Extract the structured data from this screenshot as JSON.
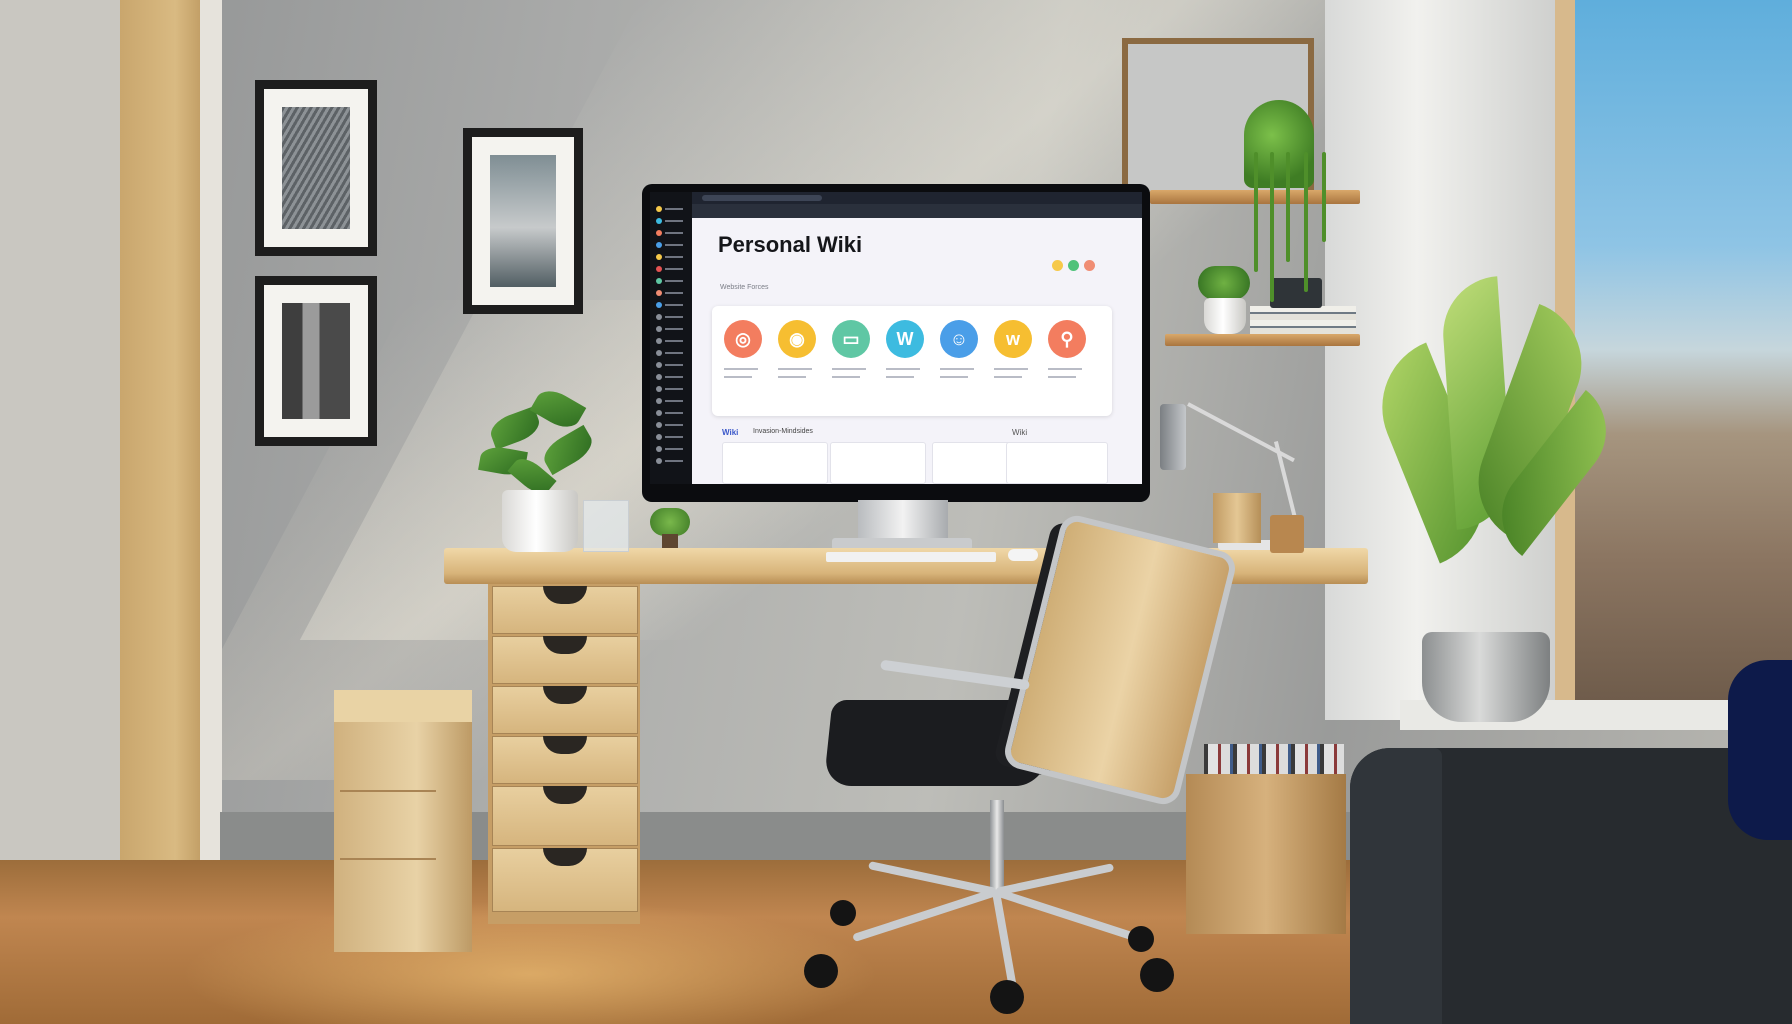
{
  "scene": "home office with desk and monitor",
  "colors": {
    "wall": "#a9aaa9",
    "desk_wood": "#d8b47a",
    "floor": "#c08650",
    "screen_bg": "#f4f3f9",
    "sidebar": "#111318",
    "accent_blue": "#3a57c9"
  },
  "screen": {
    "page_title": "Personal Wiki",
    "page_subtitle": "Website Forces",
    "header_dots": [
      "#f6c94a",
      "#4fc27a",
      "#f08d74"
    ],
    "app_icons": [
      {
        "name": "target-icon",
        "color": "#f37d5f",
        "glyph": "◎"
      },
      {
        "name": "ring-icon",
        "color": "#f6be31",
        "glyph": "◉"
      },
      {
        "name": "card-icon",
        "color": "#5fc7a4",
        "glyph": "▭"
      },
      {
        "name": "w-icon",
        "color": "#3dbbe0",
        "glyph": "W"
      },
      {
        "name": "person-icon",
        "color": "#4a9ee8",
        "glyph": "☺"
      },
      {
        "name": "wave-icon",
        "color": "#f6be31",
        "glyph": "w"
      },
      {
        "name": "pin-icon",
        "color": "#f37d5f",
        "glyph": "⚲"
      }
    ],
    "section_label_1": "Wiki",
    "section_label_2": "Invasion-Mindsides",
    "section_label_3": "Wiki"
  }
}
